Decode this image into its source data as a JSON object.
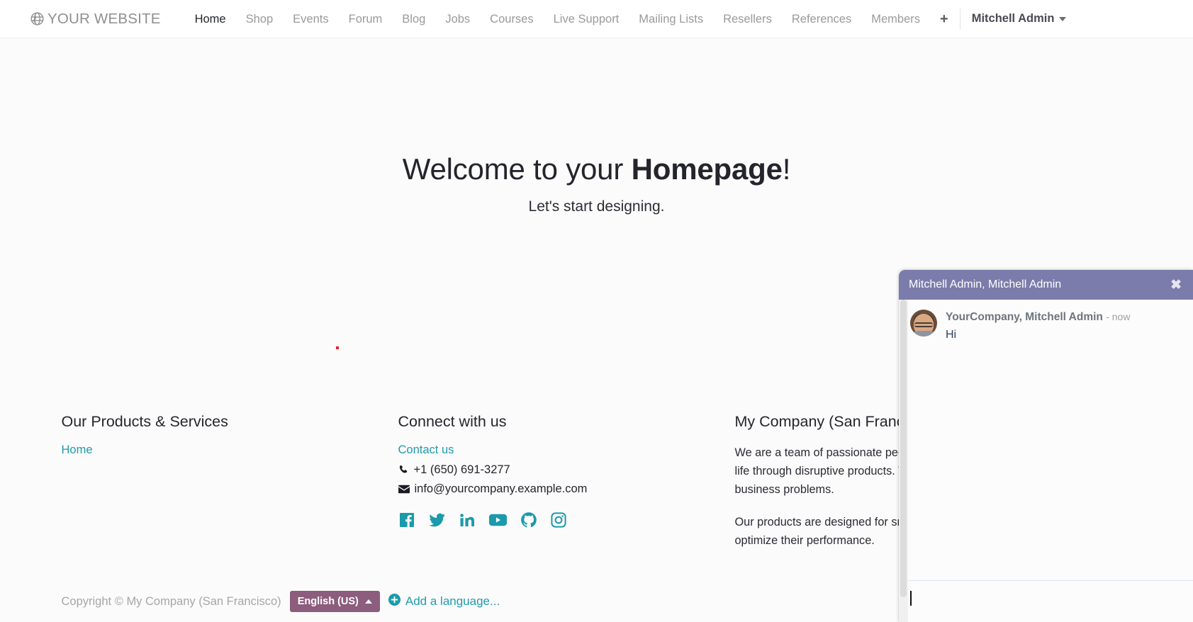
{
  "navbar": {
    "brand": "YOUR WEBSITE",
    "brand_icon": "globe-icon",
    "links": [
      {
        "label": "Home",
        "active": true
      },
      {
        "label": "Shop",
        "active": false
      },
      {
        "label": "Events",
        "active": false
      },
      {
        "label": "Forum",
        "active": false
      },
      {
        "label": "Blog",
        "active": false
      },
      {
        "label": "Jobs",
        "active": false
      },
      {
        "label": "Courses",
        "active": false
      },
      {
        "label": "Live Support",
        "active": false
      },
      {
        "label": "Mailing Lists",
        "active": false
      },
      {
        "label": "Resellers",
        "active": false
      },
      {
        "label": "References",
        "active": false
      },
      {
        "label": "Members",
        "active": false
      }
    ],
    "plus_label": "+",
    "plus_icon": "plus-icon",
    "user_name": "Mitchell Admin",
    "user_caret_icon": "chevron-down-icon"
  },
  "hero": {
    "title_prefix": "Welcome to your ",
    "title_strong": "Homepage",
    "title_suffix": "!",
    "subtitle": "Let's start designing."
  },
  "footer": {
    "col1": {
      "title": "Our Products & Services",
      "links": [
        "Home"
      ]
    },
    "col2": {
      "title": "Connect with us",
      "contact_link": "Contact us",
      "phone": "+1 (650) 691-3277",
      "phone_icon": "phone-icon",
      "email": "info@yourcompany.example.com",
      "email_icon": "envelope-icon",
      "socials": [
        {
          "name": "facebook-icon"
        },
        {
          "name": "twitter-icon"
        },
        {
          "name": "linkedin-icon"
        },
        {
          "name": "youtube-icon"
        },
        {
          "name": "github-icon"
        },
        {
          "name": "instagram-icon"
        }
      ]
    },
    "col3": {
      "title": "My Company (San Francisco)",
      "paragraph1": "We are a team of passionate people whose goal is to improve everyone's life through disruptive products. We build great products to solve your business problems.",
      "paragraph2": "Our products are designed for small to medium size companies willing to optimize their performance."
    }
  },
  "copyright": {
    "text": "Copyright © My Company (San Francisco)",
    "language_button": "English (US)",
    "language_caret_icon": "caret-up-icon",
    "add_language": "Add a language...",
    "add_language_icon": "plus-circle-icon"
  },
  "chat": {
    "title": "Mitchell Admin, Mitchell Admin",
    "close_icon": "close-icon",
    "messages": [
      {
        "author": "YourCompany, Mitchell Admin",
        "time": "- now",
        "body": "Hi",
        "avatar": "user-avatar"
      }
    ],
    "composer_value": "",
    "composer_placeholder": ""
  },
  "colors": {
    "accent_teal": "#1f9bab",
    "chat_header_purple": "#7b7cab",
    "language_button_mauve": "#8c5d7d",
    "nav_inactive": "#9a9a9a",
    "page_background": "#fbfbfb",
    "marker_red": "#e8212a"
  }
}
